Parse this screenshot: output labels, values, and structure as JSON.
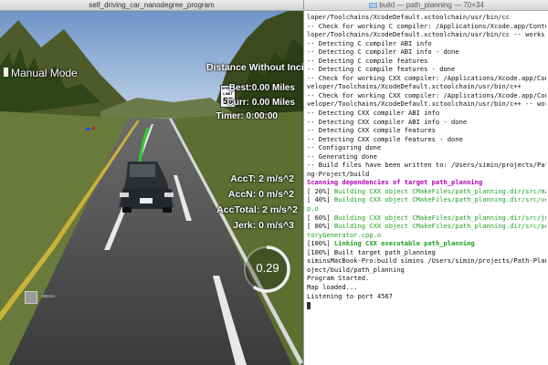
{
  "simulator": {
    "title": "self_driving_car_nanodegree_program",
    "mode_label": "Manual Mode",
    "distance_title": "Distance Without Incident",
    "speed_sign_top": "SPEED LIMIT",
    "speed_sign_value": "50",
    "best": "Best:0.00 Miles",
    "curr": "Curr: 0.00 Miles",
    "timer": "Timer: 0:00:00",
    "acc_t": "AccT: 2 m/s^2",
    "acc_n": "AccN: 0 m/s^2",
    "acc_total": "AccTotal: 2 m/s^2",
    "jerk": "Jerk: 0 m/s^3",
    "speed_gauge_value": "0.29",
    "speed_gauge_fraction": 0.6,
    "menu_label": "MENU"
  },
  "terminal": {
    "title": "build — path_planning — 70×34",
    "lines": [
      {
        "style": "plain",
        "text": "loper/Toolchains/XcodeDefault.xctoolchain/usr/bin/cc"
      },
      {
        "style": "plain",
        "text": "-- Check for working C compiler: /Applications/Xcode.app/Contents/Deve"
      },
      {
        "style": "plain",
        "text": "loper/Toolchains/XcodeDefault.xctoolchain/usr/bin/cc -- works"
      },
      {
        "style": "plain",
        "text": "-- Detecting C compiler ABI info"
      },
      {
        "style": "plain",
        "text": "-- Detecting C compiler ABI info - done"
      },
      {
        "style": "plain",
        "text": "-- Detecting C compile features"
      },
      {
        "style": "plain",
        "text": "-- Detecting C compile features - done"
      },
      {
        "style": "plain",
        "text": "-- Check for working CXX compiler: /Applications/Xcode.app/Contents/De"
      },
      {
        "style": "plain",
        "text": "veloper/Toolchains/XcodeDefault.xctoolchain/usr/bin/c++"
      },
      {
        "style": "plain",
        "text": "-- Check for working CXX compiler: /Applications/Xcode.app/Contents/De"
      },
      {
        "style": "plain",
        "text": "veloper/Toolchains/XcodeDefault.xctoolchain/usr/bin/c++ -- works"
      },
      {
        "style": "plain",
        "text": "-- Detecting CXX compiler ABI info"
      },
      {
        "style": "plain",
        "text": "-- Detecting CXX compiler ABI info - done"
      },
      {
        "style": "plain",
        "text": "-- Detecting CXX compile features"
      },
      {
        "style": "plain",
        "text": "-- Detecting CXX compile features - done"
      },
      {
        "style": "plain",
        "text": "-- Configuring done"
      },
      {
        "style": "plain",
        "text": "-- Generating done"
      },
      {
        "style": "plain",
        "text": "-- Build files have been written to: /Users/simin/projects/Path-Planni"
      },
      {
        "style": "plain",
        "text": "ng-Project/build"
      },
      {
        "style": "magenta",
        "text": "Scanning dependencies of target path_planning"
      },
      {
        "style": "pct",
        "prefix": "[ 20%] ",
        "text": "Building CXX object CMakeFiles/path_planning.dir/src/main.cpp.o"
      },
      {
        "style": "pct",
        "prefix": "[ 40%] ",
        "text": "Building CXX object CMakeFiles/path_planning.dir/src/vehicle.cp"
      },
      {
        "style": "pctcont",
        "text": "p.o"
      },
      {
        "style": "pct",
        "prefix": "[ 60%] ",
        "text": "Building CXX object CMakeFiles/path_planning.dir/src/jmt.cpp.o"
      },
      {
        "style": "pct",
        "prefix": "[ 80%] ",
        "text": "Building CXX object CMakeFiles/path_planning.dir/src/polyTrajec"
      },
      {
        "style": "pctcont",
        "text": "toryGenerator.cpp.o"
      },
      {
        "style": "link",
        "prefix": "[100%] ",
        "text": "Linking CXX executable path_planning"
      },
      {
        "style": "plain",
        "text": "[100%] Built target path_planning"
      },
      {
        "style": "plain",
        "text": "siminsMacBook-Pro:build simins /Users/simin/projects/Path-Planning-Pr"
      },
      {
        "style": "plain",
        "text": "oject/build/path_planning"
      },
      {
        "style": "plain",
        "text": "Program Started."
      },
      {
        "style": "plain",
        "text": "Map loaded..."
      },
      {
        "style": "plain",
        "text": "Listening to port 4567"
      },
      {
        "style": "cursor",
        "text": ""
      }
    ]
  },
  "colors": {
    "terminal_magenta": "#b400b4",
    "terminal_green": "#1fa11f",
    "sky": "#8fb3d9",
    "road": "#4a4a4a",
    "grass": "#5f7a2e"
  }
}
